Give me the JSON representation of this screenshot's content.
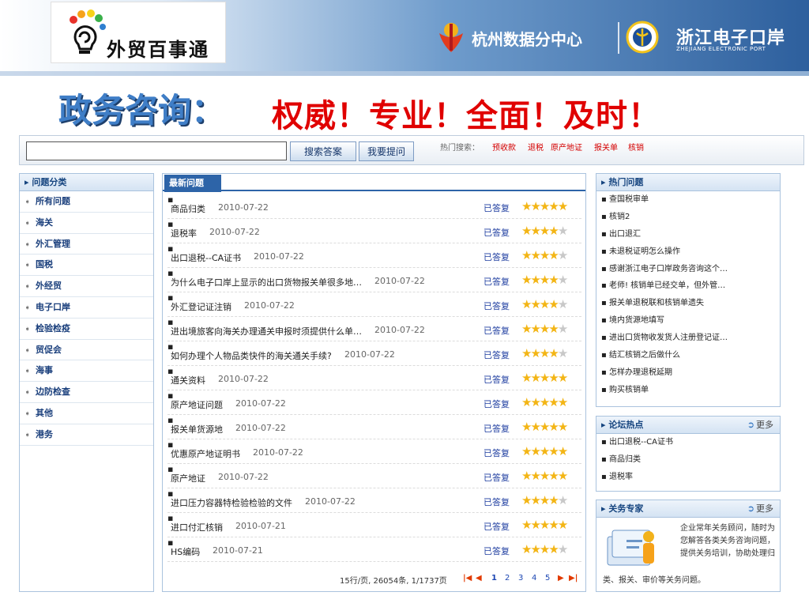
{
  "header": {
    "logo_text": "外贸百事通",
    "hangzhou": "杭州数据分中心",
    "zhejiang": "浙江电子口岸",
    "zhejiang_en": "ZHEJIANG ELECTRONIC PORT"
  },
  "slogan": {
    "main": "政务咨询：",
    "sub": "权威！专业！全面！及时！"
  },
  "search": {
    "value": "",
    "search_label": "搜索答案",
    "ask_label": "我要提问",
    "hot_label": "热门搜索：",
    "hot_keywords": [
      "预收款",
      "退税",
      "原产地证",
      "报关单",
      "核销"
    ]
  },
  "sidebar": {
    "title": "问题分类",
    "items": [
      {
        "label": "所有问题"
      },
      {
        "label": "海关"
      },
      {
        "label": "外汇管理"
      },
      {
        "label": "国税"
      },
      {
        "label": "外经贸"
      },
      {
        "label": "电子口岸"
      },
      {
        "label": "检验检疫"
      },
      {
        "label": "贸促会"
      },
      {
        "label": "海事"
      },
      {
        "label": "边防检查"
      },
      {
        "label": "其他"
      },
      {
        "label": "港务"
      }
    ]
  },
  "main": {
    "tab": "最新问题",
    "status_label": "已答复",
    "questions": [
      {
        "title": "商品归类",
        "date": "2010-07-22",
        "stars": 5
      },
      {
        "title": "退税率",
        "date": "2010-07-22",
        "stars": 4
      },
      {
        "title": "出口退税--CA证书",
        "date": "2010-07-22",
        "stars": 4
      },
      {
        "title": "为什么电子口岸上显示的出口货物报关单很多地…",
        "date": "2010-07-22",
        "stars": 4
      },
      {
        "title": "外汇登记证注销",
        "date": "2010-07-22",
        "stars": 4
      },
      {
        "title": "进出境旅客向海关办理通关申报时须提供什么单…",
        "date": "2010-07-22",
        "stars": 4
      },
      {
        "title": "如何办理个人物品类快件的海关通关手续?",
        "date": "2010-07-22",
        "stars": 4
      },
      {
        "title": "通关资料",
        "date": "2010-07-22",
        "stars": 5
      },
      {
        "title": "原产地证问题",
        "date": "2010-07-22",
        "stars": 5
      },
      {
        "title": "报关单货源地",
        "date": "2010-07-22",
        "stars": 5
      },
      {
        "title": "优惠原产地证明书",
        "date": "2010-07-22",
        "stars": 5
      },
      {
        "title": "原产地证",
        "date": "2010-07-22",
        "stars": 5
      },
      {
        "title": "进口压力容器特检验检验的文件",
        "date": "2010-07-22",
        "stars": 4
      },
      {
        "title": "进口付汇核销",
        "date": "2010-07-21",
        "stars": 5
      },
      {
        "title": "HS编码",
        "date": "2010-07-21",
        "stars": 4
      }
    ],
    "pager": {
      "summary": "15行/页, 26054条, 1/1737页",
      "pages": [
        "1",
        "2",
        "3",
        "4",
        "5"
      ]
    }
  },
  "hot_questions": {
    "title": "热门问题",
    "items": [
      "查国税审单",
      "核销2",
      "出口退汇",
      "未退税证明怎么操作",
      "感谢浙江电子口岸政务咨询这个…",
      "老师! 核销单已经交单，但外管…",
      "报关单退税联和核销单遗失",
      "境内货源地填写",
      "进出口货物收发货人注册登记证…",
      "结汇核销之后做什么",
      "怎样办理退税延期",
      "购买核销单"
    ]
  },
  "forum": {
    "title": "论坛热点",
    "more": "更多",
    "items": [
      "出口退税--CA证书",
      "商品归类",
      "退税率"
    ]
  },
  "expert": {
    "title": "关务专家",
    "more": "更多",
    "text": "企业常年关务顾问，随时为您解答各类关务咨询问题，提供关务培训，协助处理归",
    "text_2": "类、报关、审价等关务问题。"
  },
  "colors": {
    "primary_blue": "#2d64a8",
    "slogan_red": "#e00000",
    "star": "#f3b515"
  }
}
